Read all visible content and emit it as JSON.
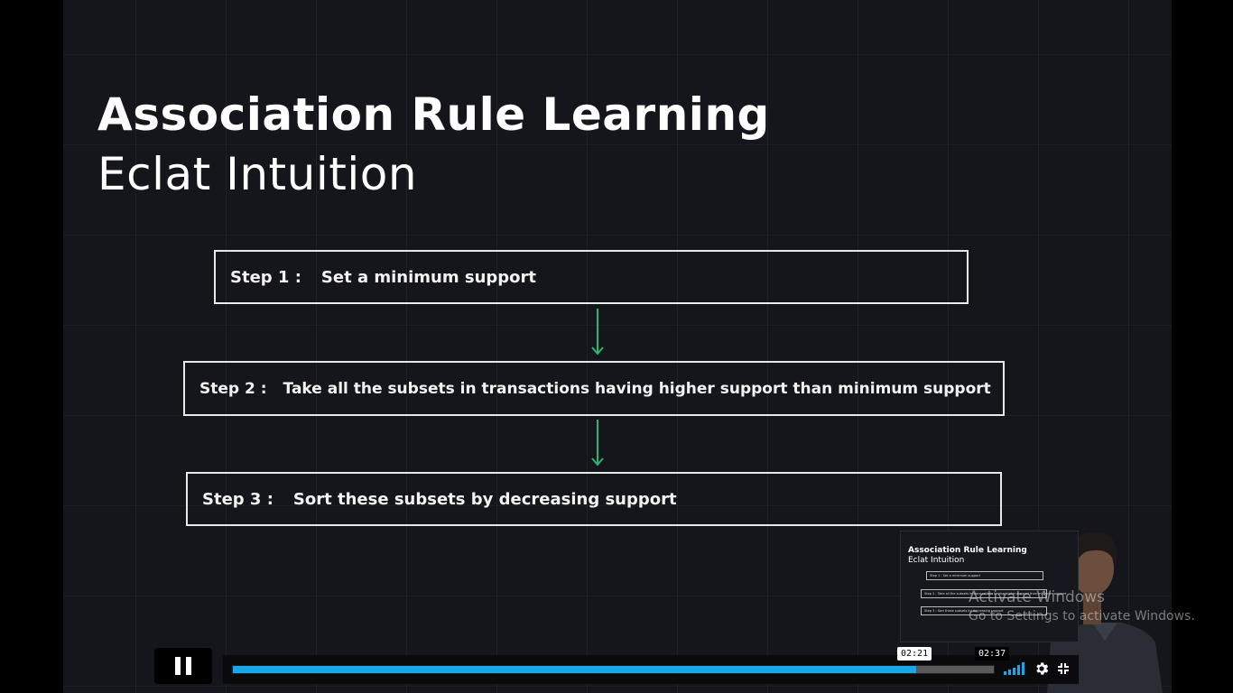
{
  "slide": {
    "title": "Association Rule Learning",
    "subtitle": "Eclat Intuition",
    "steps": [
      {
        "label": "Step 1 :",
        "text": "Set a minimum support"
      },
      {
        "label": "Step 2 :",
        "text": "Take all the subsets in transactions having higher support than minimum support"
      },
      {
        "label": "Step 3 :",
        "text": "Sort these subsets by decreasing support"
      }
    ],
    "arrow_color": "#2bb673"
  },
  "thumbnail": {
    "title": "Association Rule Learning",
    "subtitle": "Eclat Intuition",
    "steps": [
      "Step 1 :   Set a minimum support",
      "Step 2 :   Take all the subsets in transactions having higher support than minimum support",
      "Step 3 :   Sort these subsets by decreasing support"
    ]
  },
  "watermark": {
    "line1": "Activate Windows",
    "line2": "Go to Settings to activate Windows."
  },
  "player": {
    "current_time": "02:21",
    "duration": "02:37",
    "progress_fraction": 0.898,
    "accent_color": "#1aa7e8",
    "state": "playing"
  }
}
